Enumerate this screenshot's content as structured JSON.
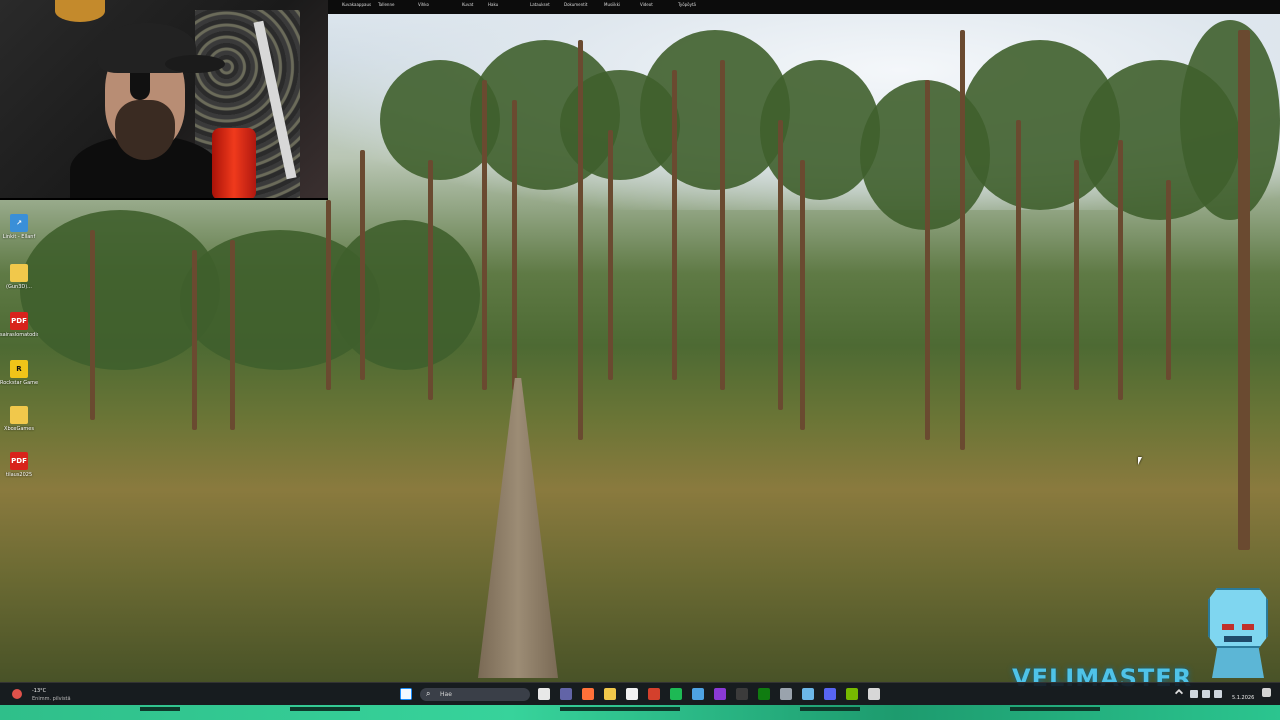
{
  "desktop": {
    "icons": [
      {
        "label": "Linkit - Ellanf"
      },
      {
        "label": "(Gun3D)..."
      },
      {
        "label": "sairaslomatodistus"
      },
      {
        "label": "Rockstar Games"
      },
      {
        "label": "XboxGames"
      },
      {
        "label": "tilaus2025"
      }
    ]
  },
  "top_strip": {
    "items": [
      "Kuvakaappaus",
      "Tallenne",
      "Vihko",
      "Kuvat",
      "Haku",
      "Lataukset",
      "Dokumentit",
      "Musiikki",
      "Videot",
      "Työpöytä"
    ]
  },
  "overlay": {
    "brand": "VELIMASTER"
  },
  "taskbar": {
    "weather": {
      "temp": "-13°C",
      "desc": "Enimm. pilvistä"
    },
    "search_placeholder": "Hae",
    "pinned": [
      {
        "name": "task-view-icon",
        "color": "#e8e8e8"
      },
      {
        "name": "teams-icon",
        "color": "#6264a7"
      },
      {
        "name": "firefox-icon",
        "color": "#ff7139"
      },
      {
        "name": "file-explorer-icon",
        "color": "#f1c84b"
      },
      {
        "name": "store-icon",
        "color": "#f2f2f2"
      },
      {
        "name": "record-icon",
        "color": "#d4402c"
      },
      {
        "name": "spotify-icon",
        "color": "#1db954"
      },
      {
        "name": "steam-icon",
        "color": "#4ea3e3"
      },
      {
        "name": "obs-icon",
        "color": "#8a3ad6"
      },
      {
        "name": "terminal-icon",
        "color": "#3b3b3b"
      },
      {
        "name": "xbox-icon",
        "color": "#107c10"
      },
      {
        "name": "settings-icon",
        "color": "#9aa3ad"
      },
      {
        "name": "snipping-icon",
        "color": "#6cb7e8"
      },
      {
        "name": "discord-icon",
        "color": "#5865f2"
      },
      {
        "name": "nvidia-icon",
        "color": "#76b900"
      },
      {
        "name": "calculator-icon",
        "color": "#d7d7d7"
      }
    ],
    "date": "5.1.2026"
  }
}
